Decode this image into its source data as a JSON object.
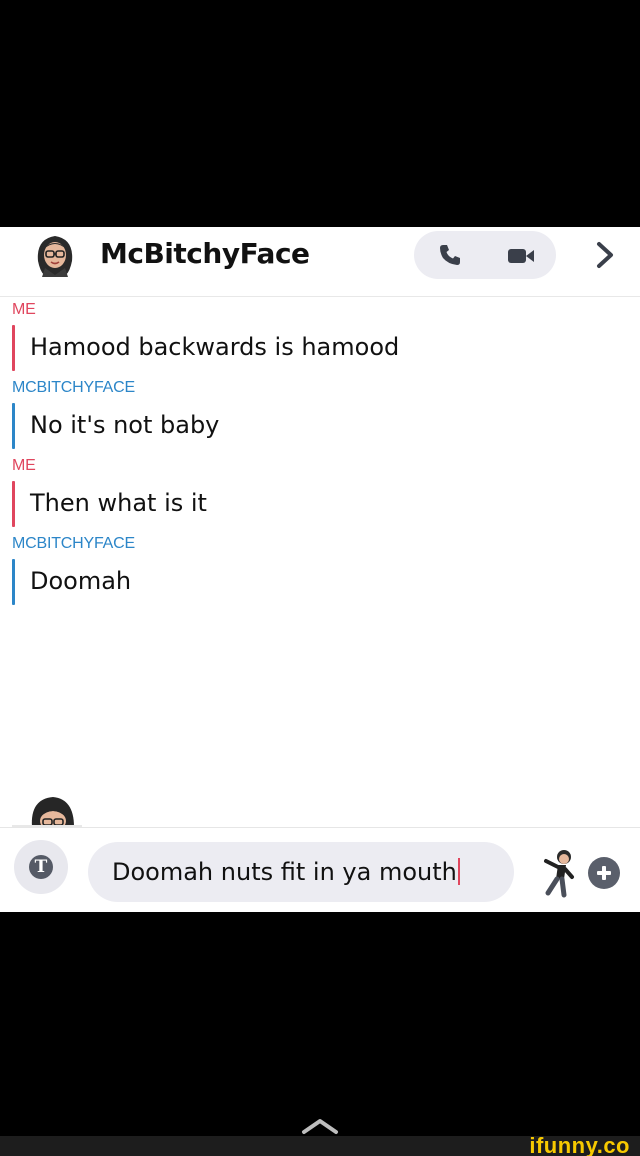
{
  "header": {
    "contact_name": "McBitchyFace",
    "call_icon": "phone-icon",
    "video_icon": "video-camera-icon",
    "chevron_icon": "chevron-right-icon"
  },
  "messages": [
    {
      "sender": "ME",
      "text": "Hamood backwards is hamood",
      "from": "me"
    },
    {
      "sender": "MCBITCHYFACE",
      "text": "No it's not baby",
      "from": "them"
    },
    {
      "sender": "ME",
      "text": "Then what is it",
      "from": "me"
    },
    {
      "sender": "MCBITCHYFACE",
      "text": "Doomah",
      "from": "them"
    }
  ],
  "composer": {
    "text_tool_glyph": "T",
    "input_value": "Doomah nuts fit in ya mouth"
  },
  "watermark": "ifunny.co",
  "colors": {
    "me": "#e0465e",
    "them": "#2c86c8",
    "watermark": "#f7c900"
  }
}
